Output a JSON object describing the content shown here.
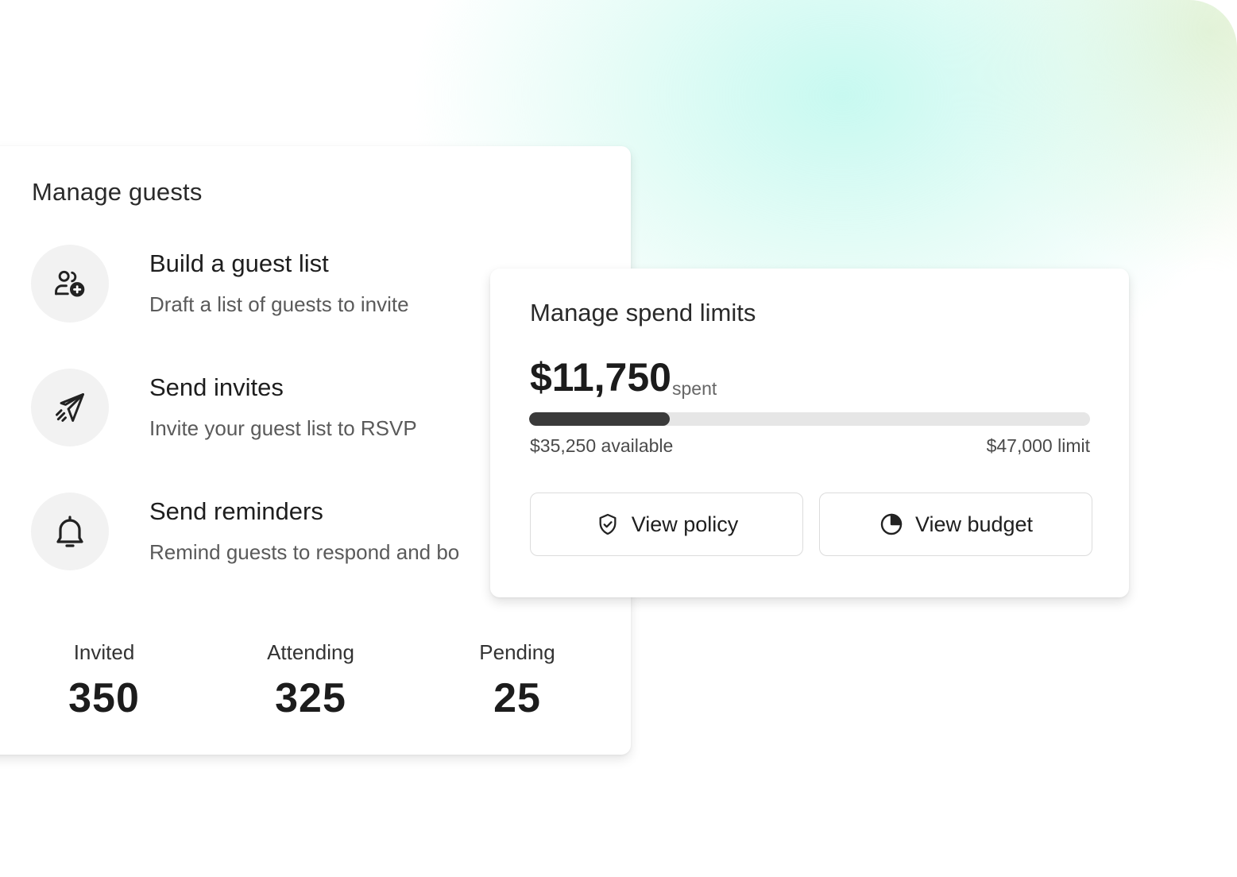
{
  "guests": {
    "title": "Manage guests",
    "items": [
      {
        "icon": "user-add-icon",
        "title": "Build a guest list",
        "subtitle": "Draft a list of guests to invite"
      },
      {
        "icon": "paper-plane-icon",
        "title": "Send invites",
        "subtitle": "Invite your guest list to RSVP"
      },
      {
        "icon": "bell-icon",
        "title": "Send reminders",
        "subtitle": "Remind guests to respond and bo"
      }
    ],
    "stats": [
      {
        "label": "Invited",
        "value": "350"
      },
      {
        "label": "Attending",
        "value": "325"
      },
      {
        "label": "Pending",
        "value": "25"
      }
    ]
  },
  "spend": {
    "title": "Manage spend limits",
    "amount": "$11,750",
    "amount_suffix": "spent",
    "progress_fraction": 0.25,
    "available": "$35,250 available",
    "limit": "$47,000 limit",
    "buttons": [
      {
        "icon": "shield-check-icon",
        "label": "View policy"
      },
      {
        "icon": "pie-chart-icon",
        "label": "View budget"
      }
    ]
  },
  "colors": {
    "progress_fill": "#3a3a3a",
    "progress_track": "#e6e6e6",
    "accent_gradient": "#bef8ee"
  }
}
